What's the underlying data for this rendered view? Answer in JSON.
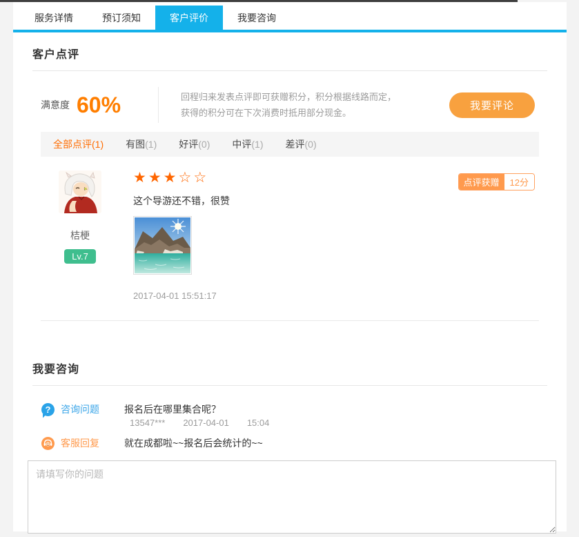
{
  "tabs": [
    {
      "label": "服务详情",
      "active": false
    },
    {
      "label": "预订须知",
      "active": false
    },
    {
      "label": "客户评价",
      "active": true
    },
    {
      "label": "我要咨询",
      "active": false
    }
  ],
  "review_section": {
    "title": "客户点评",
    "satisfaction_label": "满意度",
    "satisfaction_value": "60%",
    "promo_line1": "回程归来发表点评即可获赠积分，积分根据线路而定，",
    "promo_line2": "获得的积分可在下次消费时抵用部分现金。",
    "comment_button": "我要评论",
    "filters": [
      {
        "label": "全部点评",
        "count": "(1)",
        "active": true
      },
      {
        "label": "有图",
        "count": "(1)",
        "active": false
      },
      {
        "label": "好评",
        "count": "(0)",
        "active": false
      },
      {
        "label": "中评",
        "count": "(1)",
        "active": false
      },
      {
        "label": "差评",
        "count": "(0)",
        "active": false
      }
    ],
    "review": {
      "user": "桔梗",
      "level": "Lv.7",
      "rating": 3,
      "rating_max": 5,
      "text": "这个导游还不错，很赞",
      "timestamp": "2017-04-01 15:51:17",
      "reward_label": "点评获赠",
      "reward_value": "12分"
    }
  },
  "consult_section": {
    "title": "我要咨询",
    "question_label": "咨询问题",
    "question_text": "报名后在哪里集合呢？",
    "asker": "13547***",
    "ask_date": "2017-04-01",
    "ask_time": "15:04",
    "reply_label": "客服回复",
    "reply_text": "就在成都啦~~报名后会统计的~~",
    "input_placeholder": "请填写你的问题"
  },
  "colors": {
    "tab_active_blue": "#14b1ea",
    "accent_orange": "#ff7e00",
    "button_orange": "#f8a13f",
    "star_orange": "#ff6600",
    "reward_orange": "#ff9a4d",
    "level_green": "#3fbe8e",
    "question_blue": "#3aa5e8"
  }
}
